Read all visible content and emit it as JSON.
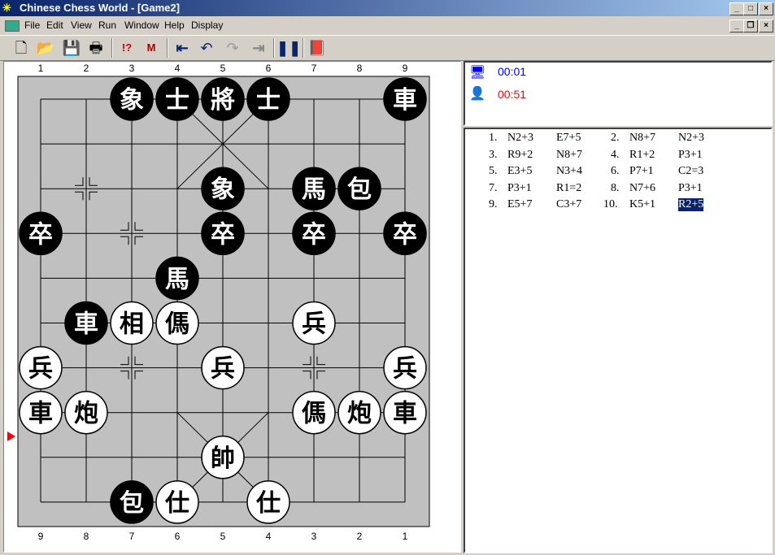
{
  "window": {
    "title": "Chinese Chess World - [Game2]",
    "logo_glyph": "棋"
  },
  "menu": [
    "File",
    "Edit",
    "View",
    "Run",
    "Window",
    "Help",
    "Display"
  ],
  "toolbar": [
    "new-file",
    "open-file",
    "save",
    "print",
    "analyze",
    "move-hint",
    "first-move",
    "undo",
    "redo",
    "last-move",
    "pause",
    "book"
  ],
  "board": {
    "top_files": [
      "1",
      "2",
      "3",
      "4",
      "5",
      "6",
      "7",
      "8",
      "9"
    ],
    "bottom_files": [
      "9",
      "8",
      "7",
      "6",
      "5",
      "4",
      "3",
      "2",
      "1"
    ],
    "black_pieces": [
      {
        "ch": "象",
        "c": 2,
        "r": 0
      },
      {
        "ch": "士",
        "c": 3,
        "r": 0
      },
      {
        "ch": "將",
        "c": 4,
        "r": 0
      },
      {
        "ch": "士",
        "c": 5,
        "r": 0
      },
      {
        "ch": "車",
        "c": 8,
        "r": 0
      },
      {
        "ch": "象",
        "c": 4,
        "r": 2
      },
      {
        "ch": "馬",
        "c": 6,
        "r": 2
      },
      {
        "ch": "包",
        "c": 7,
        "r": 2
      },
      {
        "ch": "卒",
        "c": 0,
        "r": 3
      },
      {
        "ch": "卒",
        "c": 4,
        "r": 3
      },
      {
        "ch": "卒",
        "c": 6,
        "r": 3
      },
      {
        "ch": "卒",
        "c": 8,
        "r": 3
      },
      {
        "ch": "馬",
        "c": 3,
        "r": 4
      },
      {
        "ch": "車",
        "c": 1,
        "r": 5
      },
      {
        "ch": "包",
        "c": 2,
        "r": 9
      }
    ],
    "red_pieces": [
      {
        "ch": "相",
        "c": 2,
        "r": 5
      },
      {
        "ch": "傌",
        "c": 3,
        "r": 5
      },
      {
        "ch": "兵",
        "c": 6,
        "r": 5
      },
      {
        "ch": "兵",
        "c": 0,
        "r": 6
      },
      {
        "ch": "兵",
        "c": 4,
        "r": 6
      },
      {
        "ch": "兵",
        "c": 8,
        "r": 6
      },
      {
        "ch": "車",
        "c": 0,
        "r": 7
      },
      {
        "ch": "炮",
        "c": 1,
        "r": 7
      },
      {
        "ch": "傌",
        "c": 6,
        "r": 7
      },
      {
        "ch": "炮",
        "c": 7,
        "r": 7
      },
      {
        "ch": "車",
        "c": 8,
        "r": 7
      },
      {
        "ch": "帥",
        "c": 4,
        "r": 8
      },
      {
        "ch": "仕",
        "c": 3,
        "r": 9
      },
      {
        "ch": "仕",
        "c": 5,
        "r": 9
      }
    ],
    "markers": [
      {
        "c": 1,
        "r": 2
      },
      {
        "c": 2,
        "r": 3
      },
      {
        "c": 2,
        "r": 6
      },
      {
        "c": 6,
        "r": 6
      }
    ],
    "turn_side": "bottom"
  },
  "timers": {
    "computer": "00:01",
    "human": "00:51",
    "computer_color": "#0000ff",
    "human_color": "#ff0000"
  },
  "moves": [
    [
      "1.",
      "N2+3",
      "E7+5"
    ],
    [
      "2.",
      "N8+7",
      "N2+3"
    ],
    [
      "3.",
      "R9+2",
      "N8+7"
    ],
    [
      "4.",
      "R1+2",
      "P3+1"
    ],
    [
      "5.",
      "E3+5",
      "N3+4"
    ],
    [
      "6.",
      "P7+1",
      "C2=3"
    ],
    [
      "7.",
      "P3+1",
      "R1=2"
    ],
    [
      "8.",
      "N7+6",
      "P3+1"
    ],
    [
      "9.",
      "E5+7",
      "C3+7"
    ],
    [
      "10.",
      "K5+1",
      "R2+5"
    ]
  ],
  "selected_move": "R2+5"
}
